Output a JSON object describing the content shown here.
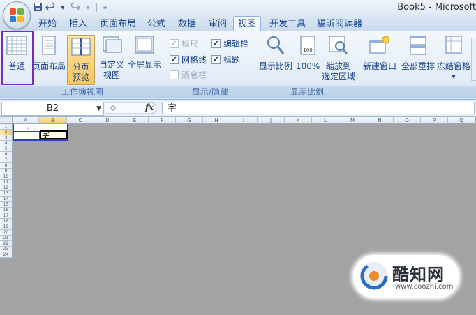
{
  "window": {
    "title": "Book5 - Microsoft"
  },
  "qat": {
    "save": "save-icon",
    "undo": "undo-icon",
    "redo": "redo-icon",
    "customize": "customize-icon"
  },
  "tabs": [
    {
      "label": "开始"
    },
    {
      "label": "插入"
    },
    {
      "label": "页面布局"
    },
    {
      "label": "公式"
    },
    {
      "label": "数据"
    },
    {
      "label": "审阅"
    },
    {
      "label": "视图"
    },
    {
      "label": "开发工具"
    },
    {
      "label": "福昕阅读器"
    }
  ],
  "active_tab": "视图",
  "ribbon": {
    "workbook_views": {
      "group_label": "工作簿视图",
      "normal": "普通",
      "page_layout": "页面布局",
      "page_break_preview_line1": "分页",
      "page_break_preview_line2": "预览",
      "custom_views_line1": "自定义",
      "custom_views_line2": "视图",
      "full_screen": "全屏显示"
    },
    "show_hide": {
      "group_label": "显示/隐藏",
      "ruler": "标尺",
      "ruler_checked": true,
      "ruler_enabled": false,
      "gridlines": "网格线",
      "gridlines_checked": true,
      "message_bar": "消息栏",
      "message_bar_checked": false,
      "message_bar_enabled": false,
      "formula_bar": "编辑栏",
      "formula_bar_checked": true,
      "headings": "标题",
      "headings_checked": true
    },
    "zoom": {
      "group_label": "显示比例",
      "zoom": "显示比例",
      "hundred": "100%",
      "zoom_selection_line1": "缩放到",
      "zoom_selection_line2": "选定区域"
    },
    "window": {
      "new_window": "新建窗口",
      "arrange_all": "全部重排",
      "freeze_panes": "冻结窗格"
    }
  },
  "formula_bar": {
    "name_box": "B2",
    "fx": "fx",
    "content": "字"
  },
  "columns": [
    "A",
    "B",
    "C",
    "D",
    "E",
    "F",
    "G",
    "H",
    "I",
    "J",
    "K",
    "L",
    "M",
    "N",
    "O",
    "P",
    "Q"
  ],
  "rows": [
    "1",
    "2",
    "3",
    "4",
    "5",
    "6",
    "7",
    "8",
    "9",
    "10",
    "11",
    "12",
    "13",
    "14",
    "15",
    "16",
    "17",
    "18",
    "19",
    "20",
    "21",
    "22",
    "23",
    "24"
  ],
  "cells": {
    "B2": "字",
    "page_label": "第1页"
  },
  "watermark": {
    "title": "酷知网",
    "url": "www.coozhi.com"
  }
}
